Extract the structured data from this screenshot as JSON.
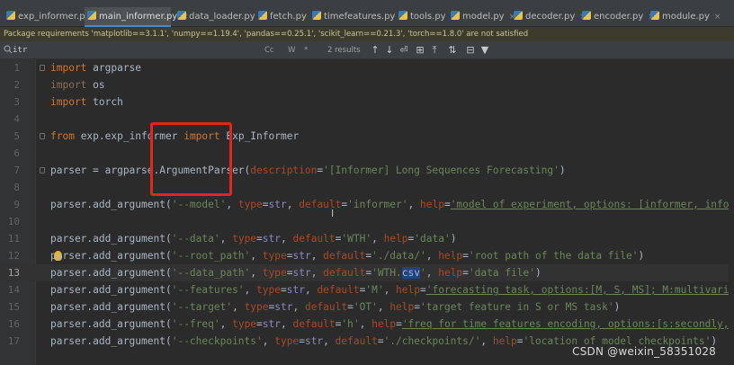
{
  "tabs": [
    {
      "label": "exp_informer.py",
      "active": false
    },
    {
      "label": "main_informer.py",
      "active": true
    },
    {
      "label": "data_loader.py",
      "active": false
    },
    {
      "label": "fetch.py",
      "active": false
    },
    {
      "label": "timefeatures.py",
      "active": false
    },
    {
      "label": "tools.py",
      "active": false
    },
    {
      "label": "model.py",
      "active": false
    },
    {
      "label": "decoder.py",
      "active": false
    },
    {
      "label": "encoder.py",
      "active": false
    },
    {
      "label": "module.py",
      "active": false
    }
  ],
  "tab_close_glyph": "×",
  "banner": {
    "text": "Package requirements 'matplotlib==3.1.1', 'numpy==1.19.4', 'pandas==0.25.1', 'scikit_learn==0.21.3', 'torch==1.8.0' are not satisfied"
  },
  "search": {
    "value": "itr",
    "icon": "search-icon",
    "options": [
      "Cc",
      "W",
      "*"
    ],
    "results": "2 results",
    "nav": [
      "↑",
      "↓",
      "⏎",
      "⊞",
      "⤒",
      "⇅",
      "⊟",
      "▼"
    ]
  },
  "editor": {
    "current_line": 13,
    "lines": [
      {
        "n": "1",
        "tokens": [
          {
            "t": "import",
            "c": "kw"
          },
          {
            "t": " argparse"
          }
        ]
      },
      {
        "n": "2",
        "tokens": [
          {
            "t": "import",
            "c": "kw-dim"
          },
          {
            "t": " os"
          }
        ]
      },
      {
        "n": "3",
        "tokens": [
          {
            "t": "import",
            "c": "kw"
          },
          {
            "t": " torch"
          }
        ]
      },
      {
        "n": "4",
        "tokens": []
      },
      {
        "n": "5",
        "tokens": [
          {
            "t": "from",
            "c": "kw"
          },
          {
            "t": " exp.exp_informer "
          },
          {
            "t": "import",
            "c": "kw"
          },
          {
            "t": " Exp_Informer"
          }
        ]
      },
      {
        "n": "6",
        "tokens": []
      },
      {
        "n": "7",
        "tokens": [
          {
            "t": "parser = argparse.ArgumentParser("
          },
          {
            "t": "description",
            "c": "pname"
          },
          {
            "t": "="
          },
          {
            "t": "'[Informer] Long Sequences Forecasting'",
            "c": "str"
          },
          {
            "t": ")"
          }
        ]
      },
      {
        "n": "8",
        "tokens": []
      },
      {
        "n": "9",
        "tokens": [
          {
            "t": "parser.add_argument("
          },
          {
            "t": "'--model'",
            "c": "str"
          },
          {
            "t": ", "
          },
          {
            "t": "type",
            "c": "pname"
          },
          {
            "t": "="
          },
          {
            "t": "str",
            "c": "bi"
          },
          {
            "t": ", "
          },
          {
            "t": "default",
            "c": "pname"
          },
          {
            "t": "="
          },
          {
            "t": "'informer'",
            "c": "str"
          },
          {
            "t": ", "
          },
          {
            "t": "help",
            "c": "pname"
          },
          {
            "t": "="
          },
          {
            "t": "'model of experiment, options: [informer, informers",
            "c": "str ul"
          }
        ]
      },
      {
        "n": "10",
        "tokens": []
      },
      {
        "n": "11",
        "tokens": [
          {
            "t": "parser.add_argument("
          },
          {
            "t": "'--data'",
            "c": "str"
          },
          {
            "t": ", "
          },
          {
            "t": "type",
            "c": "pname"
          },
          {
            "t": "="
          },
          {
            "t": "str",
            "c": "bi"
          },
          {
            "t": ", "
          },
          {
            "t": "default",
            "c": "pname"
          },
          {
            "t": "="
          },
          {
            "t": "'WTH'",
            "c": "str"
          },
          {
            "t": ", "
          },
          {
            "t": "help",
            "c": "pname"
          },
          {
            "t": "="
          },
          {
            "t": "'data'",
            "c": "str"
          },
          {
            "t": ")"
          }
        ]
      },
      {
        "n": "12",
        "tokens": [
          {
            "t": "parser.add_argument("
          },
          {
            "t": "'--root_path'",
            "c": "str"
          },
          {
            "t": ", "
          },
          {
            "t": "type",
            "c": "pname"
          },
          {
            "t": "="
          },
          {
            "t": "str",
            "c": "bi"
          },
          {
            "t": ", "
          },
          {
            "t": "default",
            "c": "pname"
          },
          {
            "t": "="
          },
          {
            "t": "'./data/'",
            "c": "str"
          },
          {
            "t": ", "
          },
          {
            "t": "help",
            "c": "pname"
          },
          {
            "t": "="
          },
          {
            "t": "'root path of the data file'",
            "c": "str"
          },
          {
            "t": ")"
          }
        ]
      },
      {
        "n": "13",
        "tokens": [
          {
            "t": "parser.add_argument("
          },
          {
            "t": "'--data_path'",
            "c": "str"
          },
          {
            "t": ", "
          },
          {
            "t": "type",
            "c": "pname"
          },
          {
            "t": "="
          },
          {
            "t": "str",
            "c": "bi"
          },
          {
            "t": ", "
          },
          {
            "t": "default",
            "c": "pname"
          },
          {
            "t": "="
          },
          {
            "t": "'WTH.",
            "c": "str"
          },
          {
            "t": "csv",
            "c": "hl"
          },
          {
            "t": "'",
            "c": "str"
          },
          {
            "t": ", "
          },
          {
            "t": "help",
            "c": "pname"
          },
          {
            "t": "="
          },
          {
            "t": "'data file'",
            "c": "str"
          },
          {
            "t": ")"
          }
        ]
      },
      {
        "n": "14",
        "tokens": [
          {
            "t": "parser.add_argument("
          },
          {
            "t": "'--features'",
            "c": "str"
          },
          {
            "t": ", "
          },
          {
            "t": "type",
            "c": "pname"
          },
          {
            "t": "="
          },
          {
            "t": "str",
            "c": "bi"
          },
          {
            "t": ", "
          },
          {
            "t": "default",
            "c": "pname"
          },
          {
            "t": "="
          },
          {
            "t": "'M'",
            "c": "str"
          },
          {
            "t": ", "
          },
          {
            "t": "help",
            "c": "pname"
          },
          {
            "t": "="
          },
          {
            "t": "'forecasting task, options:[M, S, MS]; M:multivariate",
            "c": "str ul"
          }
        ]
      },
      {
        "n": "15",
        "tokens": [
          {
            "t": "parser.add_argument("
          },
          {
            "t": "'--target'",
            "c": "str"
          },
          {
            "t": ", "
          },
          {
            "t": "type",
            "c": "pname"
          },
          {
            "t": "="
          },
          {
            "t": "str",
            "c": "bi"
          },
          {
            "t": ", "
          },
          {
            "t": "default",
            "c": "pname"
          },
          {
            "t": "="
          },
          {
            "t": "'OT'",
            "c": "str"
          },
          {
            "t": ", "
          },
          {
            "t": "help",
            "c": "pname"
          },
          {
            "t": "="
          },
          {
            "t": "'target feature in S or MS task'",
            "c": "str"
          },
          {
            "t": ")"
          }
        ]
      },
      {
        "n": "16",
        "tokens": [
          {
            "t": "parser.add_argument("
          },
          {
            "t": "'--freq'",
            "c": "str"
          },
          {
            "t": ", "
          },
          {
            "t": "type",
            "c": "pname"
          },
          {
            "t": "="
          },
          {
            "t": "str",
            "c": "bi"
          },
          {
            "t": ", "
          },
          {
            "t": "default",
            "c": "pname"
          },
          {
            "t": "="
          },
          {
            "t": "'h'",
            "c": "str"
          },
          {
            "t": ", "
          },
          {
            "t": "help",
            "c": "pname"
          },
          {
            "t": "="
          },
          {
            "t": "'freq for time features encoding, options:[s:secondly, t:m",
            "c": "str ul"
          }
        ]
      },
      {
        "n": "17",
        "tokens": [
          {
            "t": "parser.add_argument("
          },
          {
            "t": "'--checkpoints'",
            "c": "str"
          },
          {
            "t": ", "
          },
          {
            "t": "type",
            "c": "pname"
          },
          {
            "t": "="
          },
          {
            "t": "str",
            "c": "bi"
          },
          {
            "t": ", "
          },
          {
            "t": "default",
            "c": "pname"
          },
          {
            "t": "="
          },
          {
            "t": "'./checkpoints/'",
            "c": "str"
          },
          {
            "t": ", "
          },
          {
            "t": "help",
            "c": "pname"
          },
          {
            "t": "="
          },
          {
            "t": "'location of model checkpoints'",
            "c": "str"
          },
          {
            "t": ")"
          }
        ]
      }
    ]
  },
  "watermark": "CSDN @weixin_58351028",
  "colors": {
    "background": "#2b2b2b",
    "keyword": "#cc7832",
    "string": "#6a8759",
    "param": "#aa4926",
    "builtin": "#8888c6",
    "highlight_box": "#e3261b",
    "selection": "#214283"
  }
}
